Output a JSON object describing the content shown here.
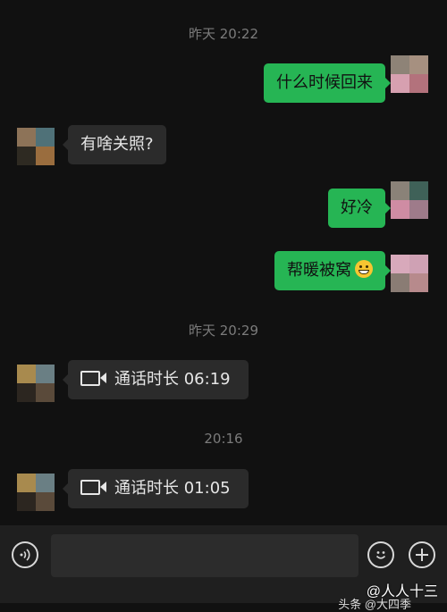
{
  "timestamps": [
    "昨天 20:22",
    "昨天 20:29",
    "20:16"
  ],
  "messages": [
    {
      "from": "self",
      "text": "什么时候回来"
    },
    {
      "from": "friend",
      "text": "有啥关照?"
    },
    {
      "from": "self",
      "text": "好冷"
    },
    {
      "from": "self",
      "text": "帮暖被窝",
      "emoji": "grinning-face-emoji"
    },
    {
      "from": "friend",
      "type": "video-call",
      "icon": "video-camera-icon",
      "text": "通话时长 06:19"
    },
    {
      "from": "friend",
      "type": "video-call",
      "icon": "video-camera-icon",
      "text": "通话时长 01:05"
    }
  ],
  "input_bar": {
    "voice_icon": "voice-input-icon",
    "emoji_icon": "emoji-icon",
    "plus_icon": "plus-icon",
    "value": ""
  },
  "watermark": {
    "line1": "@人人十三",
    "line2": "头条 @大四季"
  },
  "colors": {
    "background": "#111111",
    "outgoing_bubble": "#26b554",
    "incoming_bubble": "#2b2b2b",
    "input_bar": "#1f1f1f",
    "timestamp_text": "#7b7b7b"
  }
}
